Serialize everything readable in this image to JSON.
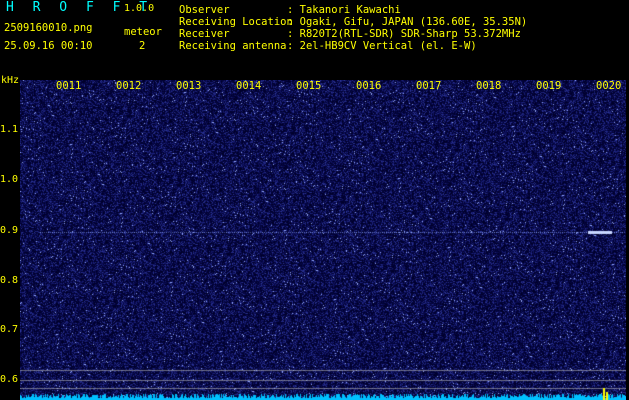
{
  "header": {
    "app_title": "H R O F F T",
    "version": "1.0.0",
    "filename": "2509160010.png",
    "meteor_label": "meteor",
    "datetime": "25.09.16 00:10",
    "meteor_count": "2"
  },
  "info": [
    {
      "key": "Observer",
      "value": ": Takanori Kawachi"
    },
    {
      "key": "Receiving Location",
      "value": ": Ogaki, Gifu, JAPAN (136.60E, 35.35N)"
    },
    {
      "key": "Receiver",
      "value": ": R820T2(RTL-SDR) SDR-Sharp 53.372MHz"
    },
    {
      "key": "Receiving antenna",
      "value": ": 2el-HB9CV Vertical (el. E-W)"
    }
  ],
  "axis": {
    "unit": "kHz",
    "y_labels": [
      "1.1",
      "1.0",
      "0.9",
      "0.8",
      "0.7",
      "0.6"
    ],
    "x_labels": [
      "0011",
      "0012",
      "0013",
      "0014",
      "0015",
      "0016",
      "0017",
      "0018",
      "0019",
      "0020"
    ]
  },
  "colors": {
    "background": "#000000",
    "spectrogram_bg": "#00003a",
    "label": "#ffff00",
    "title": "#00ffff",
    "carrier": "#8fa8ff",
    "baseline": "#00c0ff"
  }
}
